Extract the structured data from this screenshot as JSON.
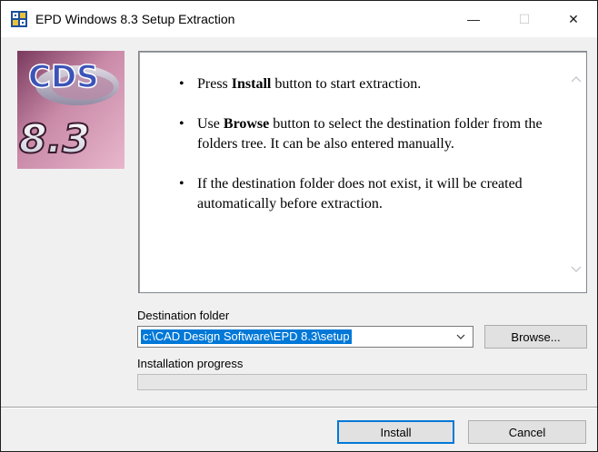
{
  "window": {
    "title": "EPD Windows 8.3 Setup Extraction",
    "minimize_glyph": "—",
    "maximize_glyph": "☐",
    "close_glyph": "✕"
  },
  "logo": {
    "brand": "CDS",
    "version": "8.3",
    "icon_name": "cds-logo"
  },
  "instructions": {
    "items": [
      {
        "bullet": "•",
        "prefix": "Press ",
        "bold": "Install",
        "suffix": " button to start extraction."
      },
      {
        "bullet": "•",
        "prefix": "Use ",
        "bold": "Browse",
        "suffix": " button to select the destination folder from the folders tree. It can be also entered manually."
      },
      {
        "bullet": "•",
        "prefix": "If the destination folder does not exist, it will be created automatically before extraction.",
        "bold": "",
        "suffix": ""
      }
    ]
  },
  "destination": {
    "label": "Destination folder",
    "value": "c:\\CAD Design Software\\EPD 8.3\\setup"
  },
  "progress": {
    "label": "Installation progress",
    "value": 0
  },
  "buttons": {
    "browse": "Browse...",
    "install": "Install",
    "cancel": "Cancel"
  },
  "colors": {
    "selection": "#0078d7",
    "default_button_border": "#0078d7",
    "dialog_background": "#f0f0f0"
  }
}
